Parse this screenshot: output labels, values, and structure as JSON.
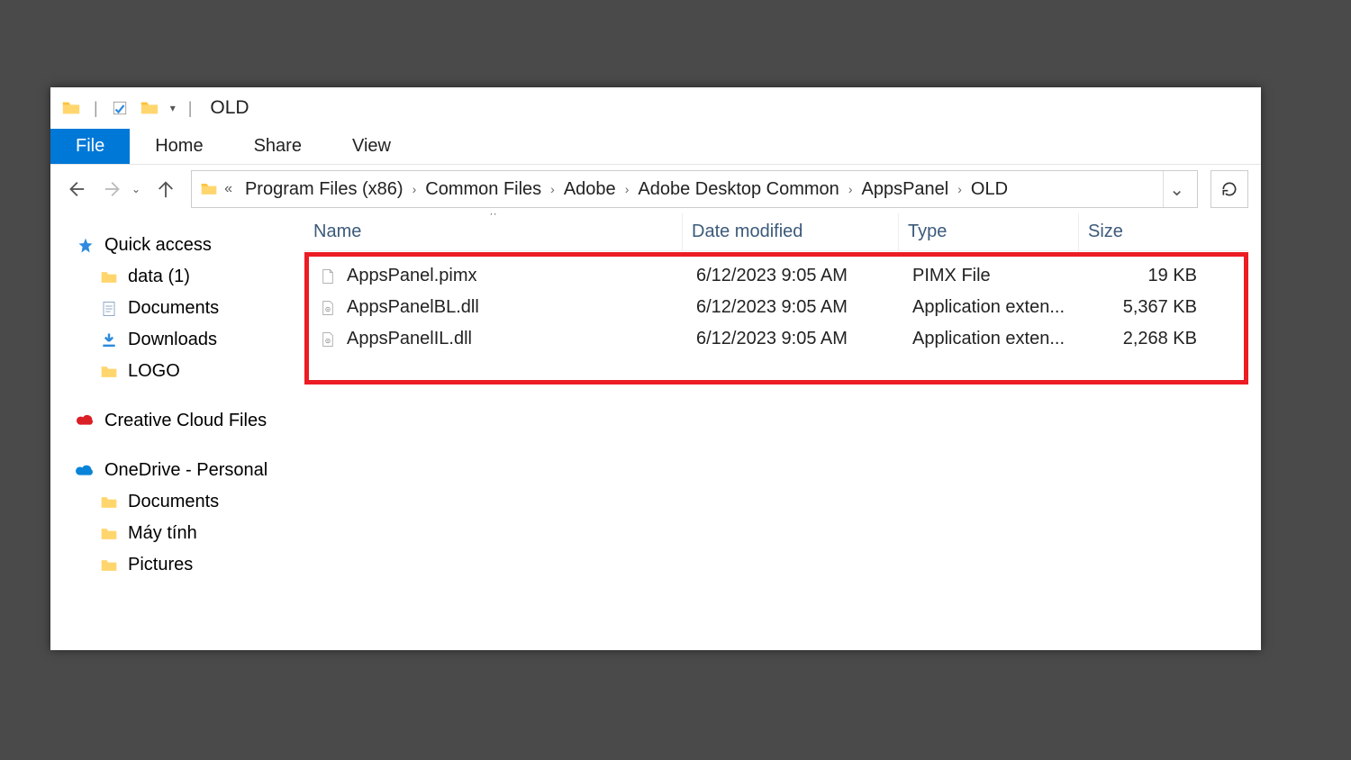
{
  "titlebar": {
    "title": "OLD"
  },
  "ribbon": {
    "tabs": {
      "file": "File",
      "home": "Home",
      "share": "Share",
      "view": "View"
    }
  },
  "address": {
    "crumbs": [
      "Program Files (x86)",
      "Common Files",
      "Adobe",
      "Adobe Desktop Common",
      "AppsPanel",
      "OLD"
    ]
  },
  "sidebar": {
    "quick_access_label": "Quick access",
    "quick_items": [
      {
        "label": "data (1)",
        "icon": "folder"
      },
      {
        "label": "Documents",
        "icon": "document"
      },
      {
        "label": "Downloads",
        "icon": "download"
      },
      {
        "label": "LOGO",
        "icon": "folder"
      }
    ],
    "creative_cloud_label": "Creative Cloud Files",
    "onedrive_label": "OneDrive - Personal",
    "onedrive_items": [
      {
        "label": "Documents"
      },
      {
        "label": "Máy tính"
      },
      {
        "label": "Pictures"
      }
    ]
  },
  "columns": {
    "name": "Name",
    "date": "Date modified",
    "type": "Type",
    "size": "Size"
  },
  "files": [
    {
      "name": "AppsPanel.pimx",
      "date": "6/12/2023 9:05 AM",
      "type": "PIMX File",
      "size": "19 KB",
      "icon": "file"
    },
    {
      "name": "AppsPanelBL.dll",
      "date": "6/12/2023 9:05 AM",
      "type": "Application exten...",
      "size": "5,367 KB",
      "icon": "gear"
    },
    {
      "name": "AppsPanelIL.dll",
      "date": "6/12/2023 9:05 AM",
      "type": "Application exten...",
      "size": "2,268 KB",
      "icon": "gear"
    }
  ]
}
